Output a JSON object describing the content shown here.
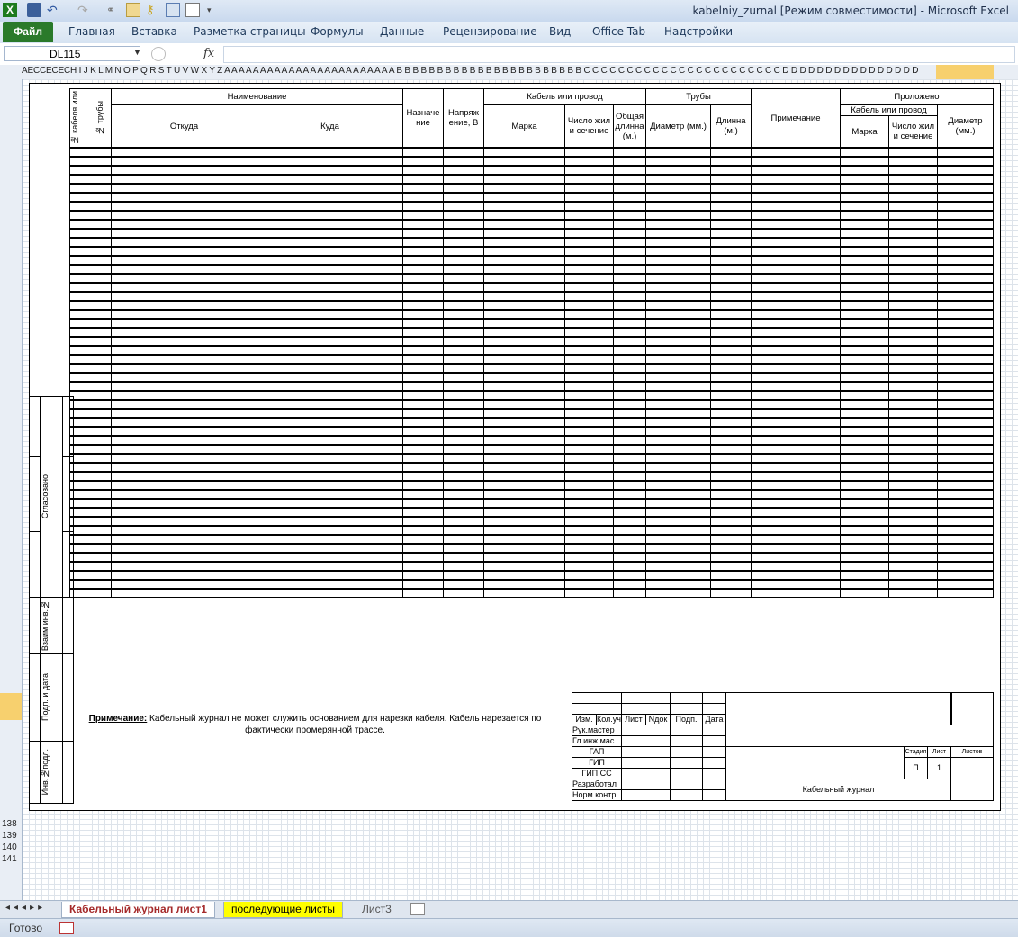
{
  "window": {
    "title": "kabelniy_zurnal  [Режим совместимости]  -  Microsoft Excel"
  },
  "ribbon": {
    "file": "Файл",
    "tabs": [
      "Главная",
      "Вставка",
      "Разметка страницы",
      "Формулы",
      "Данные",
      "Рецензирование",
      "Вид",
      "Office Tab",
      "Надстройки"
    ]
  },
  "formula_bar": {
    "name_box": "DL115",
    "fx": "fx",
    "value": ""
  },
  "column_header_text": "AECCECECH I J K L M N O P Q R S T U V W X Y Z A A A A A A A A A A A A A A A A A A A A A A A A B B B B B B B B B B B B B B B B B B B B B B B C C C C C C C C C C C C C C C C C C C C C C C D D D D D D D D D D D D D D D D",
  "row_numbers": [
    "138",
    "139",
    "140",
    "141"
  ],
  "journal": {
    "hdr_cable_no": "№ кабеля или",
    "hdr_pipe_no": "№ трубы",
    "hdr_name": "Наименование",
    "hdr_from": "Откуда",
    "hdr_to": "Куда",
    "hdr_purpose": "Назначе ние",
    "hdr_voltage": "Напряж ение, В",
    "hdr_cable": "Кабель или провод",
    "hdr_brand": "Марка",
    "hdr_cores": "Число жил и сечение",
    "hdr_length": "Общая длинна (м.)",
    "hdr_pipes": "Трубы",
    "hdr_diameter": "Диаметр (мм.)",
    "hdr_pipe_length": "Длинна (м.)",
    "hdr_note": "Примечание",
    "hdr_laid": "Проложено",
    "hdr_laid_cable": "Кабель или провод",
    "hdr_laid_brand": "Марка",
    "hdr_laid_cores": "Число жил и сечение",
    "hdr_laid_diameter": "Диаметр (мм.)"
  },
  "left_stamp": {
    "agreed": "Сгласовано",
    "interchange": "Взаим.инв.№",
    "sign_date": "Подп. и дата",
    "inv_no": "Инв.№подл."
  },
  "note": {
    "label": "Примечание:",
    "text": "Кабельный журнал не может служить основанием для нарезки кабеля. Кабель нарезается по фактически промерянной трассе."
  },
  "title_block": {
    "izm": "Изм.",
    "kol": "Кол.уч",
    "list": "Лист",
    "ndok": "Nдок",
    "podp": "Подп.",
    "data": "Дата",
    "roles": [
      "Рук.мастер",
      "Гл.инж.мас",
      "ГАП",
      "ГИП",
      "ГИП СС",
      "Разработал",
      "Норм.контр"
    ],
    "stage_hdr": "Стадия",
    "sheet_hdr": "Лист",
    "sheets_hdr": "Листов",
    "stage": "П",
    "sheet": "1",
    "doc_title": "Кабельный журнал"
  },
  "sheet_tabs": [
    "Кабельный журнал лист1",
    "последующие листы",
    "Лист3"
  ],
  "status": {
    "ready": "Готово"
  },
  "colors": {
    "file_tab": "#2a7a2a",
    "selection": "#f7d06e",
    "tab2": "#ffff00"
  }
}
